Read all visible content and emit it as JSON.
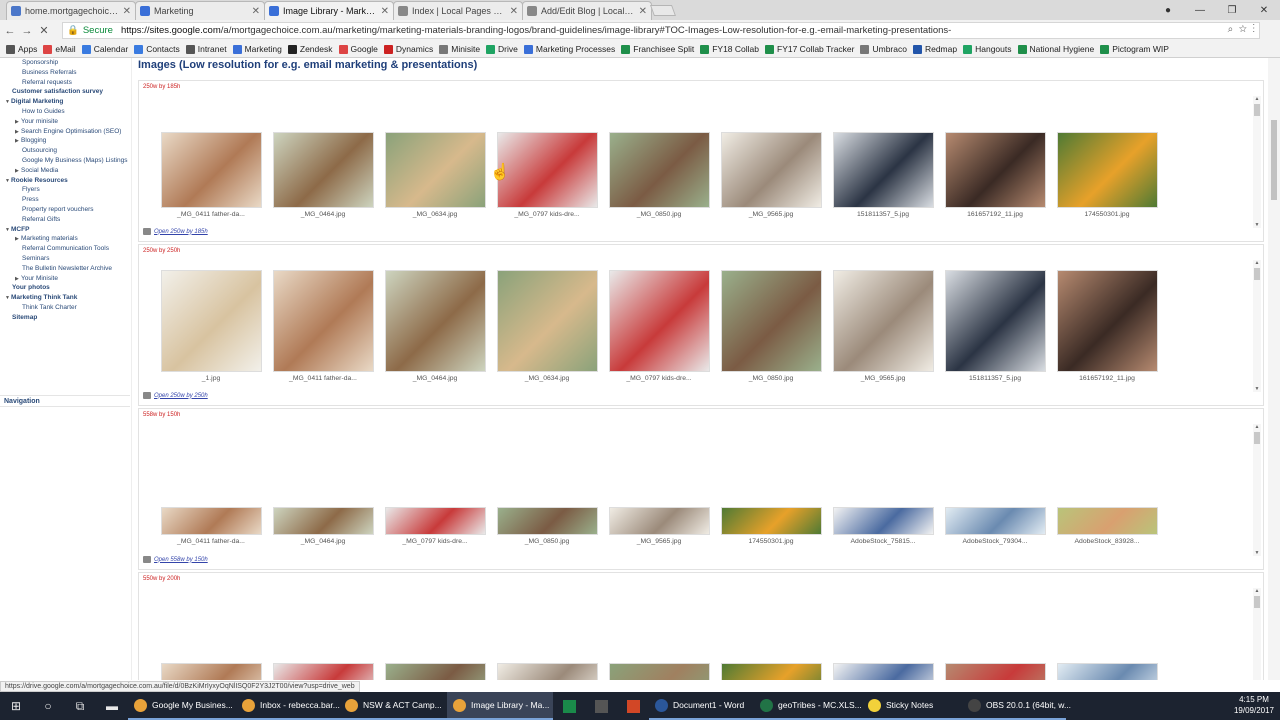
{
  "tabs": [
    {
      "label": "home.mortgagechoice.c",
      "color": "#4b77c9",
      "active": false
    },
    {
      "label": "Marketing",
      "color": "#3a6fd8",
      "active": false
    },
    {
      "label": "Image Library - Marketin",
      "color": "#3a6fd8",
      "active": true
    },
    {
      "label": "Index | Local Pages Cont",
      "color": "#888",
      "active": false
    },
    {
      "label": "Add/Edit Blog | Local Pa",
      "color": "#888",
      "active": false
    }
  ],
  "address": {
    "secure_label": "Secure",
    "url_host": "https://sites.google.com",
    "url_path": "/a/mortgagechoice.com.au/marketing/marketing-materials-branding-logos/brand-guidelines/image-library#TOC-Images-Low-resolution-for-e.g.-email-marketing-presentations-"
  },
  "bookmarks": [
    {
      "label": "Apps",
      "color": "#555"
    },
    {
      "label": "eMail",
      "color": "#d44"
    },
    {
      "label": "Calendar",
      "color": "#3a7be0"
    },
    {
      "label": "Contacts",
      "color": "#3a7be0"
    },
    {
      "label": "Intranet",
      "color": "#555"
    },
    {
      "label": "Marketing",
      "color": "#3a6fd8"
    },
    {
      "label": "Zendesk",
      "color": "#222"
    },
    {
      "label": "Google",
      "color": "#d44"
    },
    {
      "label": "Dynamics",
      "color": "#c22"
    },
    {
      "label": "Minisite",
      "color": "#777"
    },
    {
      "label": "Drive",
      "color": "#1fa463"
    },
    {
      "label": "Marketing Processes",
      "color": "#3a6fd8"
    },
    {
      "label": "Franchisee Split",
      "color": "#1f8f4a"
    },
    {
      "label": "FY18 Collab",
      "color": "#1f8f4a"
    },
    {
      "label": "FY17 Collab Tracker",
      "color": "#1f8f4a"
    },
    {
      "label": "Umbraco",
      "color": "#777"
    },
    {
      "label": "Redmap",
      "color": "#2255aa"
    },
    {
      "label": "Hangouts",
      "color": "#1fa463"
    },
    {
      "label": "National Hygiene",
      "color": "#1f8f4a"
    },
    {
      "label": "Pictogram WIP",
      "color": "#1f8f4a"
    }
  ],
  "sidebar": {
    "items": [
      {
        "label": "Sponsorship",
        "level": 1,
        "arrow": ""
      },
      {
        "label": "Business Referrals",
        "level": 1,
        "arrow": ""
      },
      {
        "label": "Referral requests",
        "level": 1,
        "arrow": ""
      },
      {
        "label": "Customer satisfaction survey",
        "level": 0,
        "arrow": ""
      },
      {
        "label": "Digital Marketing",
        "level": 0,
        "arrow": "▼"
      },
      {
        "label": "How to Guides",
        "level": 1,
        "arrow": ""
      },
      {
        "label": "Your minisite",
        "level": 1,
        "arrow": "▶"
      },
      {
        "label": "Search Engine Optimisation (SEO)",
        "level": 1,
        "arrow": "▶"
      },
      {
        "label": "Blogging",
        "level": 1,
        "arrow": "▶"
      },
      {
        "label": "Outsourcing",
        "level": 1,
        "arrow": ""
      },
      {
        "label": "Google My Business (Maps) Listings",
        "level": 1,
        "arrow": ""
      },
      {
        "label": "Social Media",
        "level": 1,
        "arrow": "▶"
      },
      {
        "label": "Rookie Resources",
        "level": 0,
        "arrow": "▼"
      },
      {
        "label": "Flyers",
        "level": 1,
        "arrow": ""
      },
      {
        "label": "Press",
        "level": 1,
        "arrow": ""
      },
      {
        "label": "Property report vouchers",
        "level": 1,
        "arrow": ""
      },
      {
        "label": "Referral Gifts",
        "level": 1,
        "arrow": ""
      },
      {
        "label": "MCFP",
        "level": 0,
        "arrow": "▼"
      },
      {
        "label": "Marketing materials",
        "level": 1,
        "arrow": "▶"
      },
      {
        "label": "Referral Communication Tools",
        "level": 1,
        "arrow": ""
      },
      {
        "label": "Seminars",
        "level": 1,
        "arrow": ""
      },
      {
        "label": "The Bulletin Newsletter Archive",
        "level": 1,
        "arrow": ""
      },
      {
        "label": "Your Minisite",
        "level": 1,
        "arrow": "▶"
      },
      {
        "label": "Your photos",
        "level": 0,
        "arrow": ""
      },
      {
        "label": "Marketing Think Tank",
        "level": 0,
        "arrow": "▼"
      },
      {
        "label": "Think Tank Charter",
        "level": 1,
        "arrow": ""
      },
      {
        "label": "Sitemap",
        "level": 0,
        "arrow": ""
      }
    ],
    "navigation_label": "Navigation"
  },
  "page_title": "Images (Low resolution for e.g. email marketing & presentations)",
  "sections": [
    {
      "title": "250w by 185h",
      "link": "Open 250w by 185h",
      "images": [
        {
          "cap": "_MG_0411 father-da...",
          "c1": "#e9d9c6",
          "c2": "#b07a56"
        },
        {
          "cap": "_MG_0464.jpg",
          "c1": "#cdd4bf",
          "c2": "#8d6a48"
        },
        {
          "cap": "_MG_0634.jpg",
          "c1": "#8aa27a",
          "c2": "#d7b98c"
        },
        {
          "cap": "_MG_0797 kids-dre...",
          "c1": "#e9e9e9",
          "c2": "#c83a3a"
        },
        {
          "cap": "_MG_0850.jpg",
          "c1": "#9ab08c",
          "c2": "#7b5b44"
        },
        {
          "cap": "_MG_9565.jpg",
          "c1": "#f0ece4",
          "c2": "#9b8a7a"
        },
        {
          "cap": "151811357_5.jpg",
          "c1": "#d9dde2",
          "c2": "#2b3444"
        },
        {
          "cap": "161657192_11.jpg",
          "c1": "#b68a70",
          "c2": "#3a2a24"
        },
        {
          "cap": "174550301.jpg",
          "c1": "#4f7a34",
          "c2": "#e7a12a"
        }
      ]
    },
    {
      "title": "250w by 250h",
      "link": "Open 250w by 250h",
      "images": [
        {
          "cap": "_1.jpg",
          "c1": "#f2f0ea",
          "c2": "#d8c3a0"
        },
        {
          "cap": "_MG_0411 father-da...",
          "c1": "#e9d9c6",
          "c2": "#b07a56"
        },
        {
          "cap": "_MG_0464.jpg",
          "c1": "#cdd4bf",
          "c2": "#8d6a48"
        },
        {
          "cap": "_MG_0634.jpg",
          "c1": "#8aa27a",
          "c2": "#d7b98c"
        },
        {
          "cap": "_MG_0797 kids-dre...",
          "c1": "#e9e9e9",
          "c2": "#c83a3a"
        },
        {
          "cap": "_MG_0850.jpg",
          "c1": "#9ab08c",
          "c2": "#7b5b44"
        },
        {
          "cap": "_MG_9565.jpg",
          "c1": "#f0ece4",
          "c2": "#9b8a7a"
        },
        {
          "cap": "151811357_5.jpg",
          "c1": "#d9dde2",
          "c2": "#2b3444"
        },
        {
          "cap": "161657192_11.jpg",
          "c1": "#b68a70",
          "c2": "#3a2a24"
        }
      ]
    },
    {
      "title": "558w by 150h",
      "link": "Open 558w by 150h",
      "images": [
        {
          "cap": "_MG_0411 father-da...",
          "c1": "#e9d9c6",
          "c2": "#b07a56"
        },
        {
          "cap": "_MG_0464.jpg",
          "c1": "#cdd4bf",
          "c2": "#8d6a48"
        },
        {
          "cap": "_MG_0797 kids-dre...",
          "c1": "#e9e9e9",
          "c2": "#c83a3a"
        },
        {
          "cap": "_MG_0850.jpg",
          "c1": "#9ab08c",
          "c2": "#7b5b44"
        },
        {
          "cap": "_MG_9565.jpg",
          "c1": "#f0ece4",
          "c2": "#9b8a7a"
        },
        {
          "cap": "174550301.jpg",
          "c1": "#4f7a34",
          "c2": "#e7a12a"
        },
        {
          "cap": "AdobeStock_75815...",
          "c1": "#f3f3f3",
          "c2": "#4a6aa0"
        },
        {
          "cap": "AdobeStock_79304...",
          "c1": "#e2ecf3",
          "c2": "#6a8ab0"
        },
        {
          "cap": "AdobeStock_83928...",
          "c1": "#b9c47a",
          "c2": "#d9a070"
        }
      ]
    },
    {
      "title": "550w by 200h",
      "link": "",
      "images": [
        {
          "cap": "",
          "c1": "#e9d9c6",
          "c2": "#b07a56"
        },
        {
          "cap": "",
          "c1": "#e9e9e9",
          "c2": "#c83a3a"
        },
        {
          "cap": "",
          "c1": "#9ab08c",
          "c2": "#7b5b44"
        },
        {
          "cap": "",
          "c1": "#f0ece4",
          "c2": "#9b8a7a"
        },
        {
          "cap": "",
          "c1": "#8aa27a",
          "c2": "#a08060"
        },
        {
          "cap": "",
          "c1": "#4f7a34",
          "c2": "#e7a12a"
        },
        {
          "cap": "",
          "c1": "#f3f3f3",
          "c2": "#4a6aa0"
        },
        {
          "cap": "",
          "c1": "#b68a70",
          "c2": "#c83a3a"
        },
        {
          "cap": "",
          "c1": "#e2ecf3",
          "c2": "#6a8ab0"
        }
      ]
    }
  ],
  "status_url": "https://drive.google.com/a/mortgagechoice.com.au/file/d/0BzKiMrIyxyOqNlISQ0F2Y3J2T00/view?usp=drive_web",
  "taskbar": {
    "apps": [
      {
        "label": "Google My Busines...",
        "color": "#e8a23a",
        "active": false
      },
      {
        "label": "Inbox - rebecca.bar...",
        "color": "#e8a23a",
        "active": false
      },
      {
        "label": "NSW & ACT Camp...",
        "color": "#e8a23a",
        "active": false
      },
      {
        "label": "Image Library - Ma...",
        "color": "#e8a23a",
        "active": true
      },
      {
        "label": "Document1 - Word",
        "color": "#2b579a",
        "active": false
      },
      {
        "label": "geoTribes - MC.XLS...",
        "color": "#217346",
        "active": false
      },
      {
        "label": "Sticky Notes",
        "color": "#f2d13a",
        "active": false
      },
      {
        "label": "OBS 20.0.1 (64bit, w...",
        "color": "#444",
        "active": false
      }
    ],
    "time": "4:15 PM",
    "date": "19/09/2017"
  }
}
